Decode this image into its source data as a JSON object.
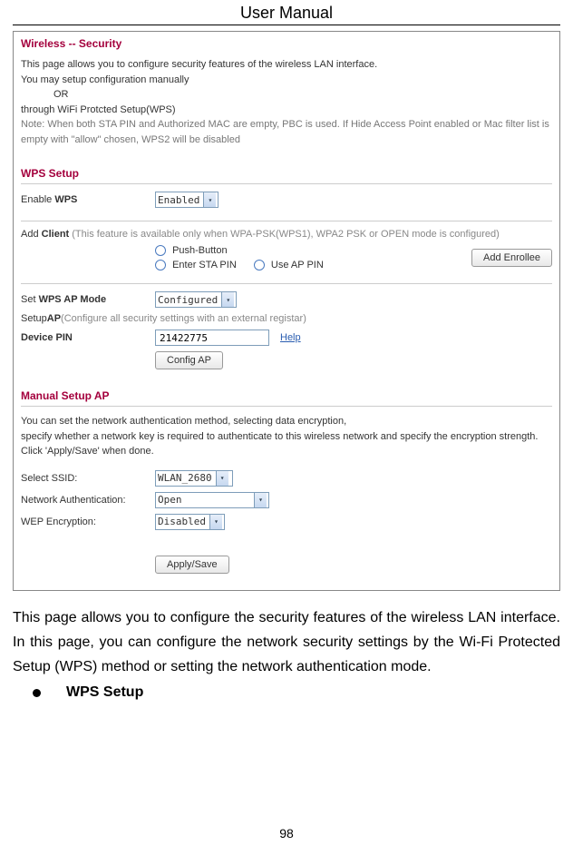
{
  "doc": {
    "header": "User Manual",
    "page_number": "98"
  },
  "screenshot": {
    "title": "Wireless -- Security",
    "intro_line1": "This page allows you to configure security features of the wireless LAN interface.",
    "intro_line2": "You may setup configuration manually",
    "intro_or": "OR",
    "intro_line3": "through WiFi Protcted Setup(WPS)",
    "note_label": "Note:",
    "note_text": " When both STA PIN and Authorized MAC are empty, PBC is used. If Hide Access Point enabled or Mac filter list is empty with \"allow\" chosen, WPS2 will be disabled",
    "wps_setup": {
      "heading": "WPS Setup",
      "enable_label_pre": "Enable ",
      "enable_label_bold": "WPS",
      "enable_value": "Enabled",
      "add_client_pre": "Add ",
      "add_client_bold": "Client",
      "add_client_note": " (This feature is available only when WPA-PSK(WPS1), WPA2 PSK or OPEN mode is configured)",
      "radio_push_button": "Push-Button",
      "radio_enter_sta": "Enter STA PIN",
      "radio_use_ap": "Use AP PIN",
      "add_enrollee_btn": "Add Enrollee",
      "set_mode_pre": "Set ",
      "set_mode_bold": "WPS AP Mode",
      "set_mode_value": "Configured",
      "setup_ap_pre": "Setup ",
      "setup_ap_bold": "AP",
      "setup_ap_note": " (Configure all security settings with an external registar)",
      "device_pin_label": "Device PIN",
      "device_pin_value": "21422775",
      "help_link": "Help",
      "config_ap_btn": "Config AP"
    },
    "manual": {
      "heading": "Manual Setup AP",
      "desc_line1": "You can set the network authentication method, selecting data encryption,",
      "desc_line2": "specify whether a network key is required to authenticate to this wireless network and specify the encryption strength.",
      "desc_line3": "Click 'Apply/Save' when done.",
      "select_ssid_label": "Select SSID:",
      "select_ssid_value": "WLAN_2680",
      "net_auth_label": "Network Authentication:",
      "net_auth_value": "Open",
      "wep_label": "WEP Encryption:",
      "wep_value": "Disabled",
      "apply_save_btn": "Apply/Save"
    }
  },
  "body": {
    "paragraph": "This page allows you to configure the security features of the wireless LAN interface. In this page, you can configure the network security settings by the Wi-Fi Protected Setup (WPS) method or setting the network authentication mode.",
    "bullet": "WPS Setup"
  }
}
